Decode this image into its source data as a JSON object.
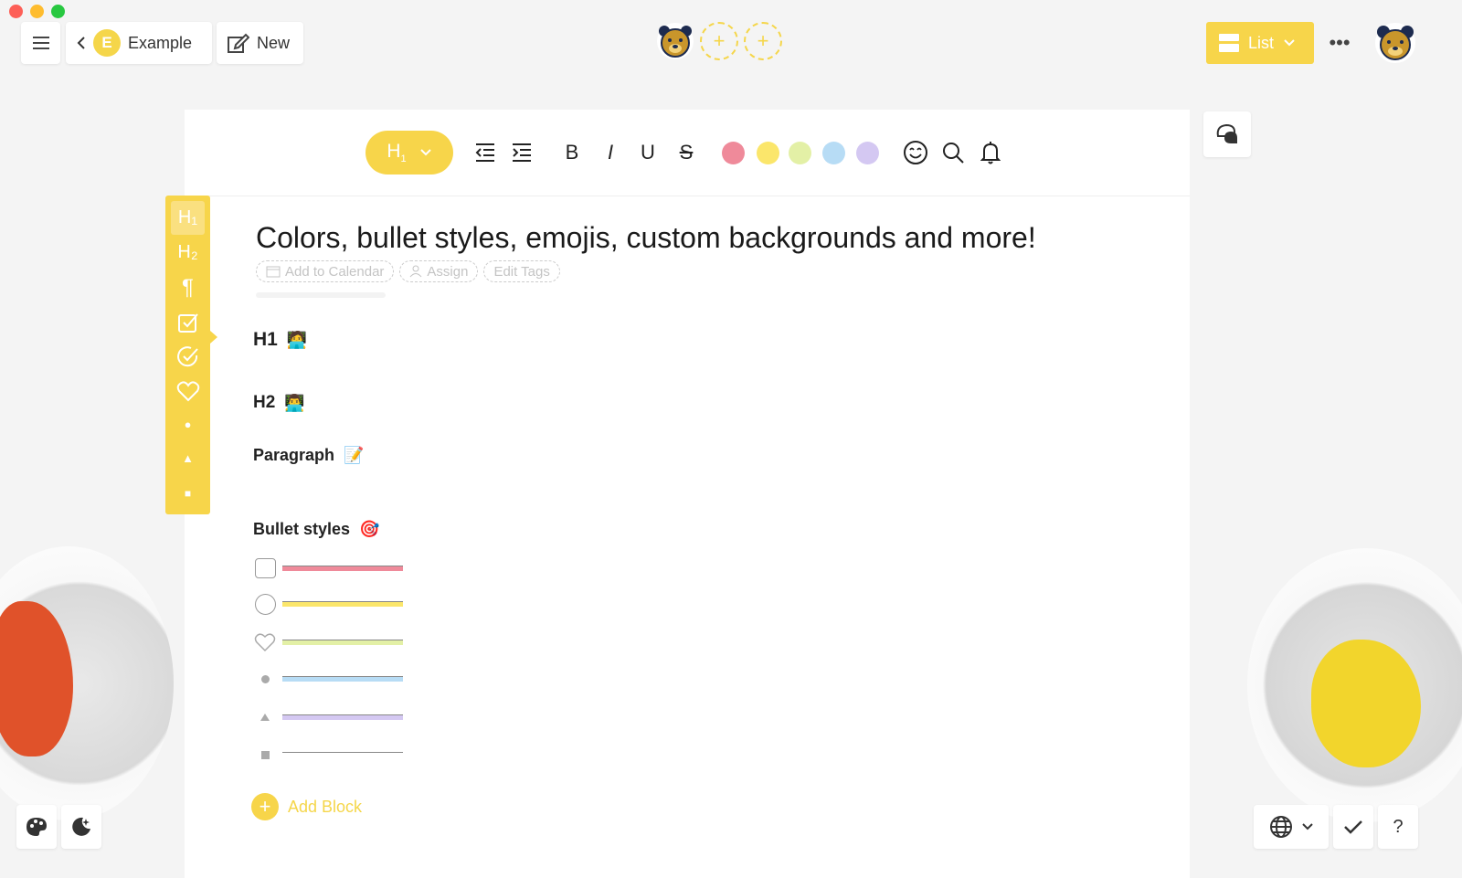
{
  "window": {
    "controls": [
      "close",
      "minimize",
      "zoom"
    ]
  },
  "topbar": {
    "menu_icon": "hamburger-icon",
    "back": {
      "icon": "chevron-left-icon",
      "badge_letter": "E",
      "label": "Example"
    },
    "new": {
      "icon": "new-note-icon",
      "label": "New"
    },
    "collaborators": {
      "avatar": "bear-avatar",
      "add_slots": [
        "+",
        "+"
      ]
    },
    "view": {
      "label": "List",
      "icon": "layout-icon"
    },
    "more_label": "•••",
    "user_avatar": "bear-avatar"
  },
  "toolbar": {
    "heading_select": {
      "label": "H",
      "sub": "1"
    },
    "indent_icons": [
      "outdent-icon",
      "indent-icon"
    ],
    "format": {
      "bold": "B",
      "italic": "I",
      "underline": "U",
      "strike": "S"
    },
    "colors": [
      "#ef8a9a",
      "#fbe66b",
      "#e3f0a6",
      "#b7dcf5",
      "#d4c8f2"
    ],
    "tools": [
      "emoji-icon",
      "search-icon",
      "bell-icon"
    ]
  },
  "type_bar": {
    "items": [
      {
        "label": "H₁",
        "name": "h1"
      },
      {
        "label": "H₂",
        "name": "h2"
      },
      {
        "label": "¶",
        "name": "paragraph"
      },
      {
        "label": "☑",
        "name": "checkbox"
      },
      {
        "label": "✓",
        "name": "check-circle"
      },
      {
        "label": "♡",
        "name": "heart"
      },
      {
        "label": "●",
        "name": "dot"
      },
      {
        "label": "▲",
        "name": "triangle"
      },
      {
        "label": "■",
        "name": "square"
      }
    ]
  },
  "document": {
    "title": "Colors, bullet styles, emojis, custom backgrounds and more!",
    "meta": {
      "calendar": "Add to Calendar",
      "assign": "Assign",
      "tags": "Edit Tags"
    },
    "blocks": {
      "h1": {
        "label": "H1",
        "emoji": "🧑‍💻"
      },
      "h2": {
        "label": "H2",
        "emoji": "👨‍💻"
      },
      "paragraph": {
        "label": "Paragraph",
        "emoji": "📝"
      },
      "bullets": {
        "label": "Bullet styles",
        "emoji": "🎯"
      }
    },
    "bullet_rows": [
      {
        "style": "checkbox",
        "color": "#ef8a9a"
      },
      {
        "style": "circle",
        "color": "#fbe66b"
      },
      {
        "style": "heart",
        "color": "#e3f0a6"
      },
      {
        "style": "dot",
        "color": "#b7dcf5"
      },
      {
        "style": "triangle",
        "color": "#d4c8f2"
      },
      {
        "style": "square",
        "color": "#ffffff"
      }
    ],
    "add_block": "Add Block"
  },
  "bottom": {
    "palette_icon": "palette-icon",
    "night_icon": "night-mode-icon",
    "globe_icon": "globe-icon",
    "check_icon": "check-icon",
    "help": "?"
  }
}
